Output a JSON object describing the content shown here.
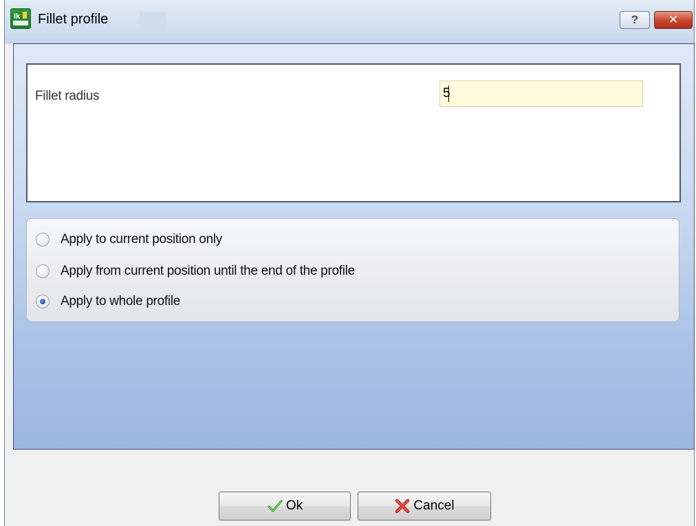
{
  "window": {
    "title": "Fillet profile",
    "help_button": "?",
    "close_button": "✕"
  },
  "form": {
    "fillet_radius_label": "Fillet radius",
    "fillet_radius_value": "5"
  },
  "apply_options": [
    {
      "label": "Apply to current position only",
      "selected": false
    },
    {
      "label": "Apply from current position until the end of the profile",
      "selected": false
    },
    {
      "label": "Apply to whole profile",
      "selected": true
    }
  ],
  "buttons": {
    "ok_label": "Ok",
    "cancel_label": "Cancel"
  },
  "colors": {
    "accent_blue": "#9ab7e3",
    "input_background": "#fffbdc",
    "close_red": "#c7442a"
  },
  "icons": {
    "app": "fillet-profile-app-icon",
    "ok": "check-icon",
    "cancel": "x-icon"
  }
}
